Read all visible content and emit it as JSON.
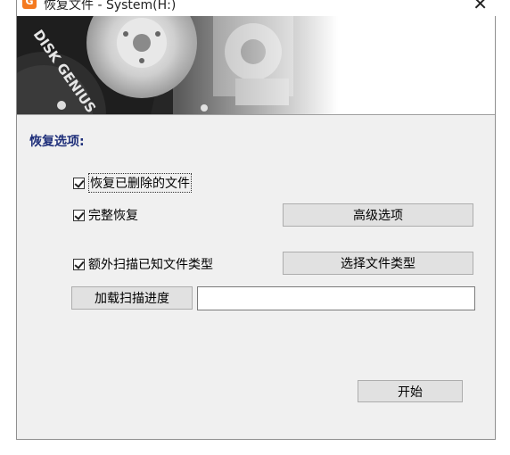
{
  "window": {
    "title": "恢复文件 - System(H:)",
    "close_glyph": "✕",
    "banner_logo_text": "DISK GENIUS"
  },
  "options": {
    "section_title": "恢复选项:",
    "recover_deleted": {
      "label": "恢复已删除的文件",
      "checked": true
    },
    "full_recovery": {
      "label": "完整恢复",
      "checked": true
    },
    "extra_scan": {
      "label": "额外扫描已知文件类型",
      "checked": true
    }
  },
  "buttons": {
    "advanced": "高级选项",
    "select_types": "选择文件类型",
    "load_progress": "加载扫描进度",
    "start": "开始"
  },
  "progress_path": {
    "value": ""
  }
}
